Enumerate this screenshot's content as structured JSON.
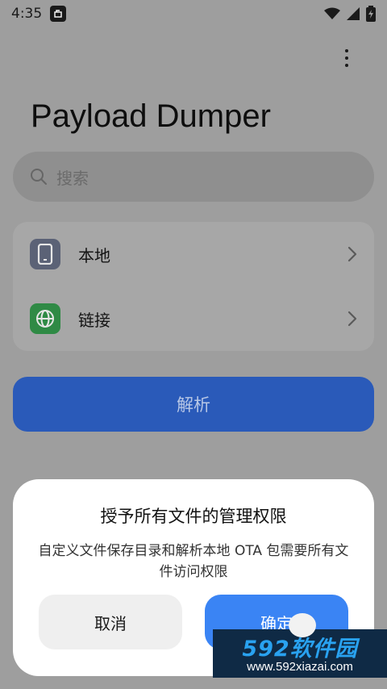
{
  "status_bar": {
    "time": "4:35",
    "notification_icon": "screenshot-icon",
    "wifi_icon": "wifi-icon",
    "signal_icon": "cell-signal-icon",
    "battery_icon": "battery-charging-icon"
  },
  "header": {
    "title": "Payload Dumper",
    "more_icon": "more-vertical-icon"
  },
  "search": {
    "placeholder": "搜索",
    "icon": "search-icon"
  },
  "sources": [
    {
      "label": "本地",
      "icon": "phone-icon",
      "color": "#5b6276"
    },
    {
      "label": "链接",
      "icon": "globe-icon",
      "color": "#2f8a45"
    }
  ],
  "actions": {
    "parse_label": "解析"
  },
  "dialog": {
    "title": "授予所有文件的管理权限",
    "message": "自定义文件保存目录和解析本地 OTA 包需要所有文件访问权限",
    "cancel_label": "取消",
    "confirm_label": "确定"
  },
  "watermark": {
    "brand": "592软件园",
    "url": "www.592xiazai.com"
  },
  "colors": {
    "primary": "#2a5ab9",
    "dialog_confirm": "#3a84f4",
    "scrim": "#9e9e9e"
  }
}
